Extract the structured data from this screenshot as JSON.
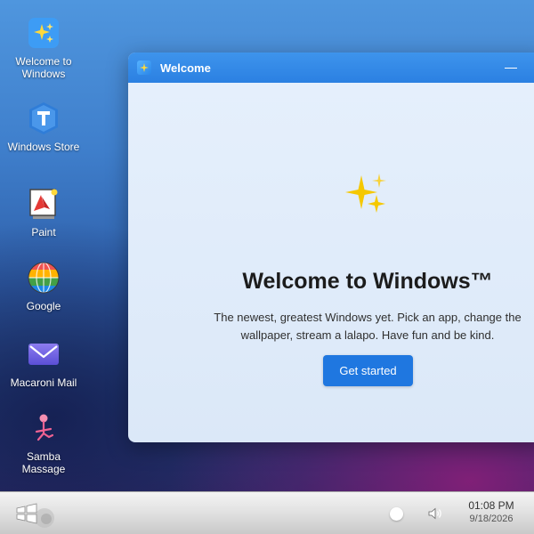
{
  "desktop": {
    "icons": [
      {
        "label": "Welcome to Windows",
        "icon": "sparkles-icon"
      },
      {
        "label": "Windows Store",
        "icon": "store-shield-icon"
      },
      {
        "label": "Paint",
        "icon": "paint-canvas-icon"
      },
      {
        "label": "Google",
        "icon": "globe-icon"
      },
      {
        "label": "Macaroni Mail",
        "icon": "mail-envelope-icon"
      },
      {
        "label": "Samba Massage",
        "icon": "samba-figure-icon"
      }
    ]
  },
  "window": {
    "title": "Welcome",
    "heading": "Welcome to Windows™",
    "body_lines": [
      "The newest, greatest Windows yet. Pick an app, change the",
      "wallpaper, stream a lalapo. Have fun and be kind."
    ],
    "button_label": "Get started",
    "accent_color": "#1f77e0"
  },
  "taskbar": {
    "time": "01:08 PM",
    "date": "9/18/2026"
  }
}
